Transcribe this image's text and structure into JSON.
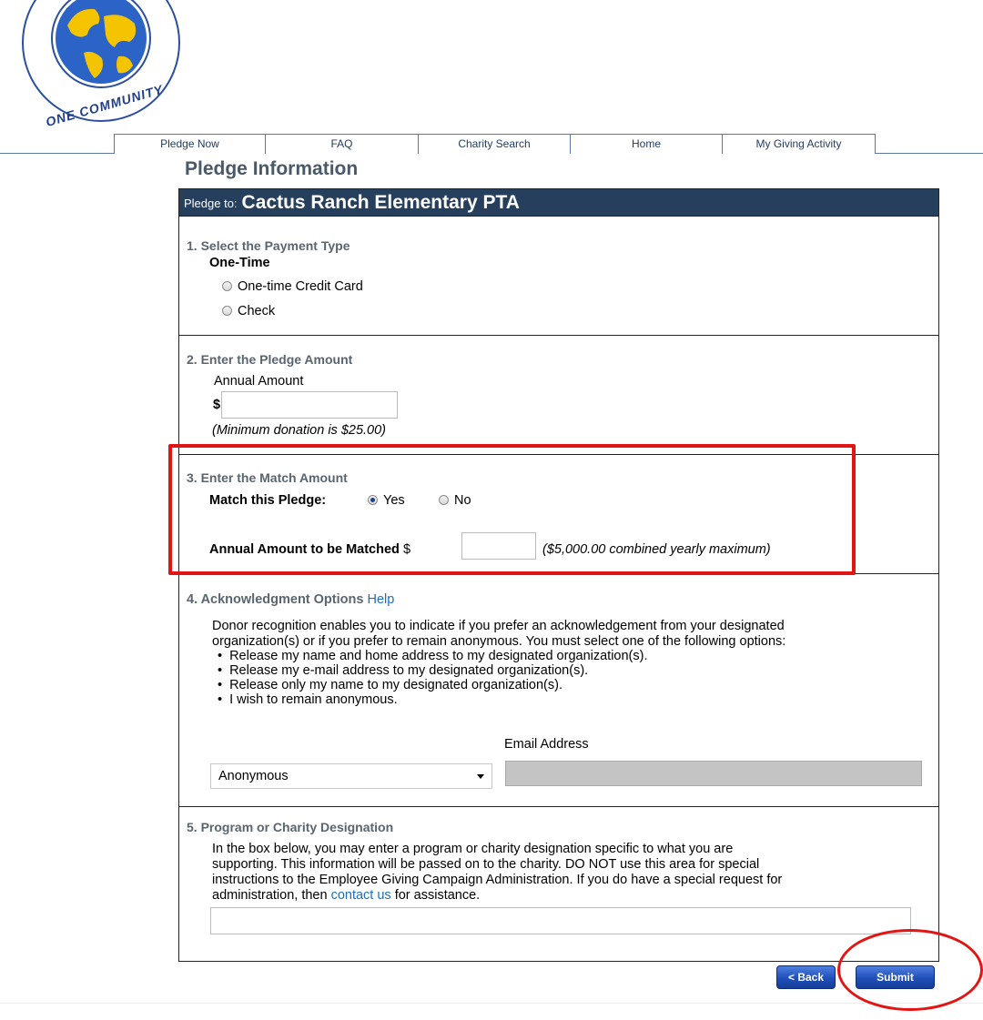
{
  "logo": {
    "text": "ONE COMMUNITY",
    "icon": "globe-logo-icon"
  },
  "nav": {
    "tabs": [
      {
        "label": "Pledge Now"
      },
      {
        "label": "FAQ"
      },
      {
        "label": "Charity Search"
      },
      {
        "label": "Home"
      },
      {
        "label": "My Giving Activity"
      }
    ]
  },
  "page": {
    "title": "Pledge Information"
  },
  "pledge": {
    "prefix": "Pledge to:",
    "organization": "Cactus Ranch Elementary PTA"
  },
  "section1": {
    "title": "1. Select the Payment Type",
    "subtitle": "One-Time",
    "options": [
      "One-time Credit Card",
      "Check"
    ]
  },
  "section2": {
    "title": "2. Enter the Pledge Amount",
    "label": "Annual Amount",
    "currency": "$",
    "value": "",
    "note": "(Minimum donation is $25.00)"
  },
  "section3": {
    "title": "3. Enter the Match Amount",
    "match_label": "Match this Pledge:",
    "yes_label": "Yes",
    "no_label": "No",
    "selected": "Yes",
    "amount_label": "Annual Amount to be Matched",
    "currency": "$",
    "value": "",
    "note": "($5,000.00 combined yearly maximum)"
  },
  "section4": {
    "title": "4. Acknowledgment Options",
    "help_link": "Help",
    "description_line1": "Donor recognition enables you to indicate if you prefer an acknowledgement from your designated",
    "description_line2": "organization(s) or if you prefer to remain anonymous. You must select one of the following options:",
    "options": [
      "Release my name and home address to my designated organization(s).",
      "Release my e-mail address to my designated organization(s).",
      "Release only my name to my designated organization(s).",
      "I wish to remain anonymous."
    ],
    "email_label": "Email Address",
    "select_value": "Anonymous",
    "email_value": ""
  },
  "section5": {
    "title": "5. Program or Charity Designation",
    "line1": "In the box below, you may enter a program or charity designation specific to what you are",
    "line2": "supporting. This information will be passed on to the charity. DO NOT use this area for special",
    "line3": "instructions to the Employee Giving Campaign Administration. If you do have a special request for",
    "line4_before": "administration, then",
    "line4_link": "contact us",
    "line4_after": "for assistance.",
    "value": ""
  },
  "buttons": {
    "back": "< Back",
    "submit": "Submit"
  },
  "colors": {
    "header_bg": "#253f5c",
    "annotation": "#e31414",
    "button": "#1f4fb8",
    "link": "#1a6fc0"
  }
}
